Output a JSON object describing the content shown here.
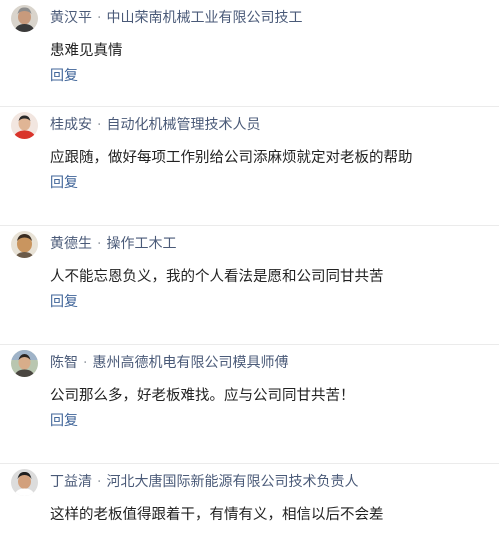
{
  "comments": [
    {
      "author": "黄汉平",
      "separator": "·",
      "title": "中山荣南机械工业有限公司技工",
      "content": "患难见真情",
      "reply_label": "回复",
      "avatar_icon": "user-avatar-gray-hair"
    },
    {
      "author": "桂成安",
      "separator": "·",
      "title": "自动化机械管理技术人员",
      "content": "应跟随，做好每项工作别给公司添麻烦就定对老板的帮助",
      "reply_label": "回复",
      "avatar_icon": "user-avatar-red-shirt"
    },
    {
      "author": "黄德生",
      "separator": "·",
      "title": "操作工木工",
      "content": "人不能忘恩负义，我的个人看法是愿和公司同甘共苦",
      "reply_label": "回复",
      "avatar_icon": "user-avatar-tan-face"
    },
    {
      "author": "陈智",
      "separator": "·",
      "title": "惠州高德机电有限公司模具师傅",
      "content": "公司那么多，好老板难找。应与公司同甘共苦！",
      "reply_label": "回复",
      "avatar_icon": "user-avatar-outdoor"
    },
    {
      "author": "丁益清",
      "separator": "·",
      "title": "河北大唐国际新能源有限公司技术负责人",
      "content": "这样的老板值得跟着干，有情有义，相信以后不会差",
      "reply_label": "",
      "avatar_icon": "user-avatar-short-hair"
    }
  ]
}
